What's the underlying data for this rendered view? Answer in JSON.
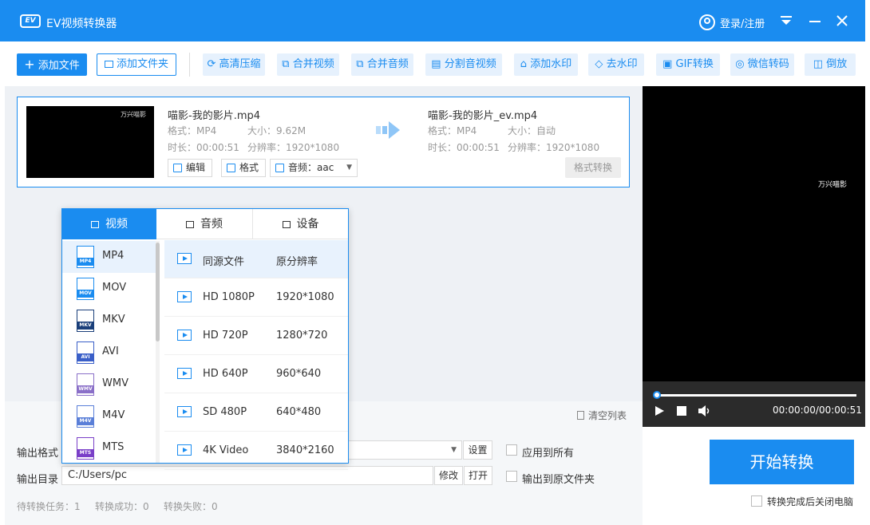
{
  "window": {
    "logo_text": "EV",
    "title": "EV视频转换器",
    "login": "登录/注册"
  },
  "toolbar": {
    "add_file": "添加文件",
    "add_folder": "添加文件夹",
    "tools": [
      "高清压缩",
      "合并视频",
      "合并音频",
      "分割音视频",
      "添加水印",
      "去水印",
      "GIF转换",
      "微信转码",
      "倒放"
    ]
  },
  "file": {
    "watermark": "万兴喵影",
    "src_name": "喵影-我的影片.mp4",
    "src_format": "格式：MP4",
    "src_size": "大小：9.62M",
    "src_duration": "时长：00:00:51",
    "src_resolution": "分辨率：1920*1080",
    "dst_name": "喵影-我的影片_ev.mp4",
    "dst_format": "格式：MP4",
    "dst_size": "大小：自动",
    "dst_duration": "时长：00:00:51",
    "dst_resolution": "分辨率：1920*1080",
    "edit": "编辑",
    "format": "格式",
    "audio": "音频：aac",
    "convert_format": "格式转换"
  },
  "panel": {
    "tabs": [
      "视频",
      "音频",
      "设备"
    ],
    "formats": [
      "MP4",
      "MOV",
      "MKV",
      "AVI",
      "WMV",
      "M4V",
      "MTS"
    ],
    "format_colors": [
      "#1a8cf0",
      "#1a8cf0",
      "#1a3f7a",
      "#3a5fc8",
      "#8a6fc8",
      "#5a7fd8",
      "#7a3fc8"
    ],
    "resolutions": [
      {
        "name": "同源文件",
        "value": "原分辨率"
      },
      {
        "name": "HD 1080P",
        "value": "1920*1080"
      },
      {
        "name": "HD 720P",
        "value": "1280*720"
      },
      {
        "name": "HD 640P",
        "value": "960*640"
      },
      {
        "name": "SD 480P",
        "value": "640*480"
      },
      {
        "name": "4K Video",
        "value": "3840*2160"
      }
    ]
  },
  "bottom": {
    "clear_list": "清空列表",
    "output_format_label": "输出格式",
    "settings": "设置",
    "apply_all": "应用到所有",
    "output_dir_label": "输出目录",
    "output_dir": "C:/Users/pc",
    "modify": "修改",
    "open": "打开",
    "output_to_source": "输出到原文件夹",
    "pending": "待转换任务：1",
    "success": "转换成功：0",
    "failed": "转换失败：0",
    "start": "开始转换",
    "shutdown": "转换完成后关闭电脑"
  },
  "player": {
    "watermark": "万兴喵影",
    "time": "00:00:00/00:00:51",
    "progress": 0
  }
}
